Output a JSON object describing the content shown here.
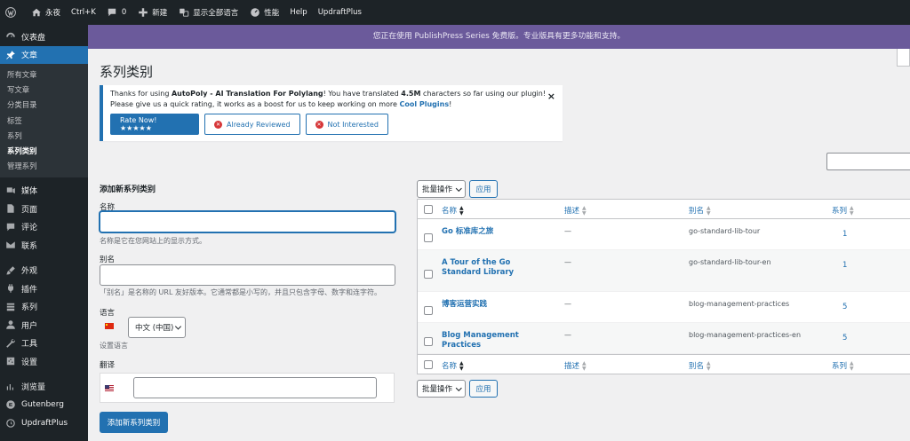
{
  "adminbar": {
    "site": "永夜",
    "shortcut": "Ctrl+K",
    "comments": "0",
    "new": "新建",
    "languages": "显示全部语言",
    "performance": "性能",
    "help": "Help",
    "updraft": "UpdraftPlus"
  },
  "sidebar": {
    "items": [
      {
        "label": "仪表盘",
        "icon": "dashboard-icon"
      },
      {
        "label": "文章",
        "icon": "pin-icon",
        "active": true
      },
      {
        "label": "媒体",
        "icon": "media-icon"
      },
      {
        "label": "页面",
        "icon": "page-icon"
      },
      {
        "label": "评论",
        "icon": "comment-icon"
      },
      {
        "label": "联系",
        "icon": "mail-icon"
      },
      {
        "label": "外观",
        "icon": "brush-icon"
      },
      {
        "label": "插件",
        "icon": "plugin-icon"
      },
      {
        "label": "系列",
        "icon": "series-icon"
      },
      {
        "label": "用户",
        "icon": "user-icon"
      },
      {
        "label": "工具",
        "icon": "wrench-icon"
      },
      {
        "label": "设置",
        "icon": "settings-icon"
      },
      {
        "label": "浏览量",
        "icon": "chart-icon"
      },
      {
        "label": "Gutenberg",
        "icon": "gutenberg-icon"
      },
      {
        "label": "UpdraftPlus",
        "icon": "updraft-icon"
      }
    ],
    "submenu": [
      "所有文章",
      "写文章",
      "分类目录",
      "标签",
      "系列",
      "系列类别",
      "管理系列"
    ]
  },
  "banner": "您正在使用 PublishPress Series 免费版。专业版具有更多功能和支持。",
  "page_title": "系列类别",
  "notice": {
    "line1_pre": "Thanks for using ",
    "plugin": "AutoPoly - AI Translation For Polylang",
    "line1_mid": "! You have translated ",
    "amount": "4.5M",
    "line1_post": " characters so far using our plugin!",
    "line2_pre": "Please give us a quick rating, it works as a boost for us to keep working on more ",
    "link": "Cool Plugins",
    "line2_post": "!",
    "close": "×",
    "rate_btn": "Rate Now! ★★★★★",
    "reviewed_btn": "Already Reviewed",
    "not_interested_btn": "Not Interested"
  },
  "form": {
    "title": "添加新系列类别",
    "name_label": "名称",
    "name_value": "",
    "name_desc": "名称是它在您网站上的显示方式。",
    "slug_label": "别名",
    "slug_value": "",
    "slug_desc": "「别名」是名称的 URL 友好版本。它通常都是小写的，并且只包含字母、数字和连字符。",
    "lang_label": "语言",
    "lang_value": "中文 (中国)",
    "lang_desc": "设置语言",
    "trans_label": "翻译",
    "trans_value": "",
    "submit": "添加新系列类别"
  },
  "bulk": {
    "label": "批量操作",
    "apply": "应用"
  },
  "table": {
    "columns": {
      "name": "名称",
      "desc": "描述",
      "slug": "别名",
      "count": "系列"
    },
    "rows": [
      {
        "name": "Go 标准库之旅",
        "desc": "—",
        "slug": "go-standard-lib-tour",
        "count": "1"
      },
      {
        "name": "A Tour of the Go Standard Library",
        "desc": "—",
        "slug": "go-standard-lib-tour-en",
        "count": "1"
      },
      {
        "name": "博客运营实践",
        "desc": "—",
        "slug": "blog-management-practices",
        "count": "5"
      },
      {
        "name": "Blog Management Practices",
        "desc": "—",
        "slug": "blog-management-practices-en",
        "count": "5"
      }
    ]
  }
}
